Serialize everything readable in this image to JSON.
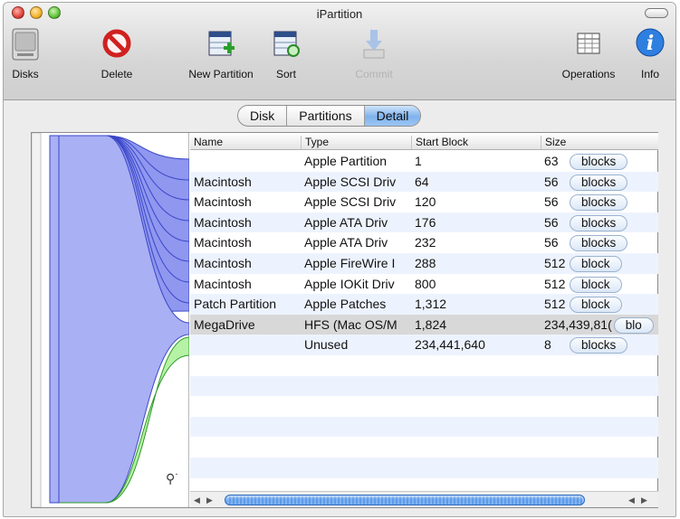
{
  "window": {
    "title": "iPartition"
  },
  "toolbar": {
    "disks": "Disks",
    "delete": "Delete",
    "new_partition": "New Partition",
    "sort": "Sort",
    "commit": "Commit",
    "operations": "Operations",
    "info": "Info"
  },
  "tabs": {
    "disk": "Disk",
    "partitions": "Partitions",
    "detail": "Detail",
    "active": "Detail"
  },
  "table": {
    "headers": {
      "name": "Name",
      "type": "Type",
      "start": "Start Block",
      "size": "Size"
    },
    "rows": [
      {
        "name": "",
        "type": "Apple Partition",
        "start": "1",
        "size": "63",
        "unit": "blocks"
      },
      {
        "name": "Macintosh",
        "type": "Apple SCSI Driv",
        "start": "64",
        "size": "56",
        "unit": "blocks"
      },
      {
        "name": "Macintosh",
        "type": "Apple SCSI Driv",
        "start": "120",
        "size": "56",
        "unit": "blocks"
      },
      {
        "name": "Macintosh",
        "type": "Apple ATA Driv",
        "start": "176",
        "size": "56",
        "unit": "blocks"
      },
      {
        "name": "Macintosh",
        "type": "Apple ATA Driv",
        "start": "232",
        "size": "56",
        "unit": "blocks"
      },
      {
        "name": "Macintosh",
        "type": "Apple FireWire I",
        "start": "288",
        "size": "512",
        "unit": "block"
      },
      {
        "name": "Macintosh",
        "type": "Apple IOKit Driv",
        "start": "800",
        "size": "512",
        "unit": "block"
      },
      {
        "name": "Patch Partition",
        "type": "Apple Patches",
        "start": "1,312",
        "size": "512",
        "unit": "block"
      },
      {
        "name": "MegaDrive",
        "type": "HFS (Mac OS/M",
        "start": "1,824",
        "size": "234,439,81(",
        "unit": "blo"
      },
      {
        "name": "",
        "type": "Unused",
        "start": "234,441,640",
        "size": "8",
        "unit": "blocks"
      }
    ],
    "selected_row": 8
  },
  "colors": {
    "partition_fill": "#8f97ef",
    "partition_stroke": "#3a46c8",
    "free_fill": "#b6f2a6",
    "free_stroke": "#2e9a2a",
    "main_fill": "#a9b0f3"
  }
}
